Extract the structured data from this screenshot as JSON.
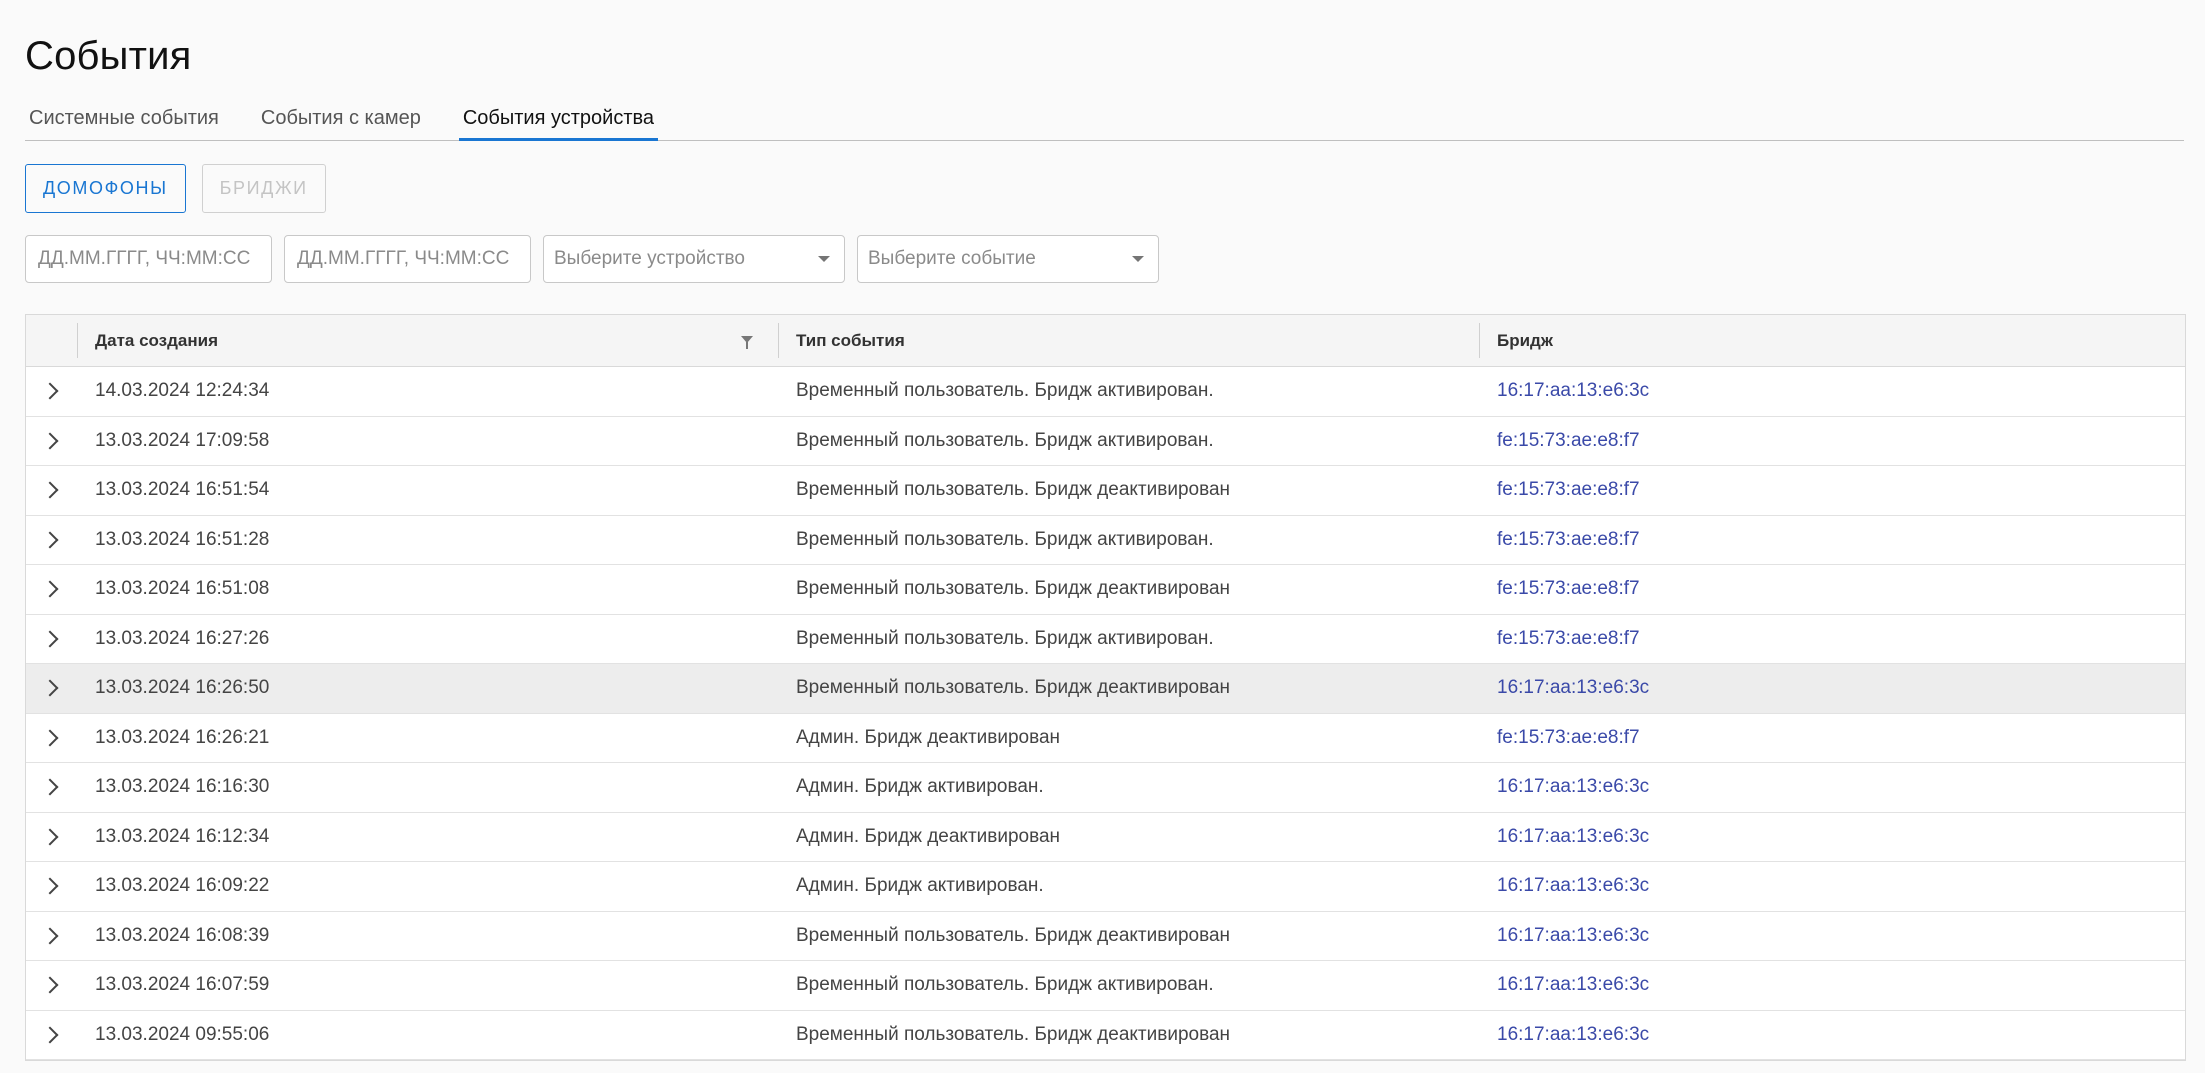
{
  "page_title": "События",
  "tabs": [
    {
      "label": "Системные события",
      "active": false
    },
    {
      "label": "События с камер",
      "active": false
    },
    {
      "label": "События устройства",
      "active": true
    }
  ],
  "toggle": {
    "intercoms_label": "ДОМОФОНЫ",
    "bridges_label": "БРИДЖИ"
  },
  "filters": {
    "date_from_placeholder": "ДД.ММ.ГГГГ, ЧЧ:ММ:СС",
    "date_to_placeholder": "ДД.ММ.ГГГГ, ЧЧ:ММ:СС",
    "device_placeholder": "Выберите устройство",
    "event_placeholder": "Выберите событие"
  },
  "table": {
    "headers": {
      "date": "Дата создания",
      "type": "Тип события",
      "bridge": "Бридж"
    },
    "rows": [
      {
        "date": "14.03.2024 12:24:34",
        "type": "Временный пользователь. Бридж активирован.",
        "bridge": "16:17:aa:13:e6:3c"
      },
      {
        "date": "13.03.2024 17:09:58",
        "type": "Временный пользователь. Бридж активирован.",
        "bridge": "fe:15:73:ae:e8:f7"
      },
      {
        "date": "13.03.2024 16:51:54",
        "type": "Временный пользователь. Бридж деактивирован",
        "bridge": "fe:15:73:ae:e8:f7"
      },
      {
        "date": "13.03.2024 16:51:28",
        "type": "Временный пользователь. Бридж активирован.",
        "bridge": "fe:15:73:ae:e8:f7"
      },
      {
        "date": "13.03.2024 16:51:08",
        "type": "Временный пользователь. Бридж деактивирован",
        "bridge": "fe:15:73:ae:e8:f7"
      },
      {
        "date": "13.03.2024 16:27:26",
        "type": "Временный пользователь. Бридж активирован.",
        "bridge": "fe:15:73:ae:e8:f7"
      },
      {
        "date": "13.03.2024 16:26:50",
        "type": "Временный пользователь. Бридж деактивирован",
        "bridge": "16:17:aa:13:e6:3c"
      },
      {
        "date": "13.03.2024 16:26:21",
        "type": "Админ. Бридж деактивирован",
        "bridge": "fe:15:73:ae:e8:f7"
      },
      {
        "date": "13.03.2024 16:16:30",
        "type": "Админ. Бридж активирован.",
        "bridge": "16:17:aa:13:e6:3c"
      },
      {
        "date": "13.03.2024 16:12:34",
        "type": "Админ. Бридж деактивирован",
        "bridge": "16:17:aa:13:e6:3c"
      },
      {
        "date": "13.03.2024 16:09:22",
        "type": "Админ. Бридж активирован.",
        "bridge": "16:17:aa:13:e6:3c"
      },
      {
        "date": "13.03.2024 16:08:39",
        "type": "Временный пользователь. Бридж деактивирован",
        "bridge": "16:17:aa:13:e6:3c"
      },
      {
        "date": "13.03.2024 16:07:59",
        "type": "Временный пользователь. Бридж активирован.",
        "bridge": "16:17:aa:13:e6:3c"
      },
      {
        "date": "13.03.2024 09:55:06",
        "type": "Временный пользователь. Бридж деактивирован",
        "bridge": "16:17:aa:13:e6:3c"
      }
    ]
  },
  "colors": {
    "accent": "#1976d2",
    "link": "#3a49a8",
    "row_highlight": "#ededed"
  },
  "icons": {
    "expand": "chevron-right-icon",
    "column_filter": "filter-icon",
    "select_arrow": "caret-down-icon"
  }
}
